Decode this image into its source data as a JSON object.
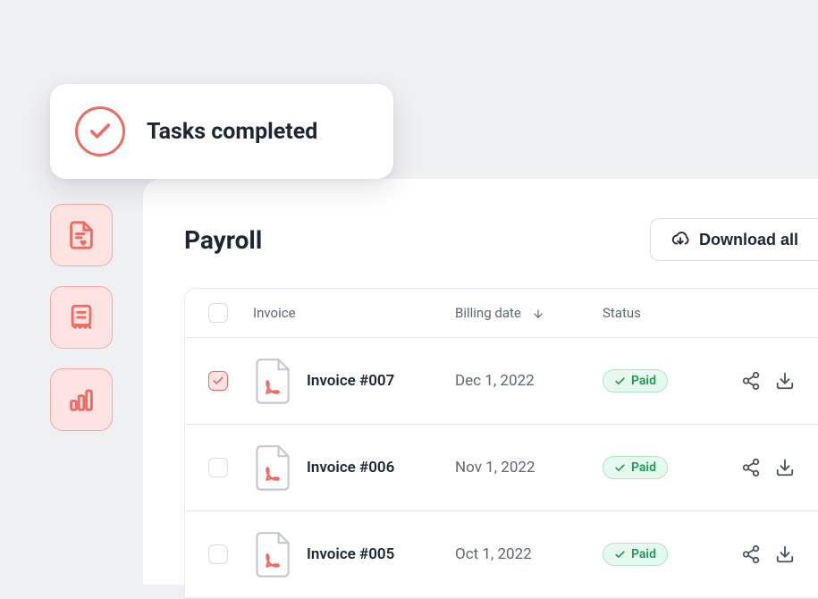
{
  "toast": {
    "message": "Tasks completed"
  },
  "sidebar": {
    "items": [
      {
        "name": "document-heart-icon"
      },
      {
        "name": "receipt-icon"
      },
      {
        "name": "bar-chart-icon"
      }
    ]
  },
  "panel": {
    "title": "Payroll",
    "download_all_label": "Download all"
  },
  "table": {
    "columns": {
      "invoice": "Invoice",
      "billing_date": "Billing date",
      "status": "Status"
    },
    "sort": {
      "column": "billing_date",
      "direction": "desc"
    },
    "rows": [
      {
        "checked": true,
        "name": "Invoice #007",
        "date": "Dec 1, 2022",
        "status": "Paid"
      },
      {
        "checked": false,
        "name": "Invoice #006",
        "date": "Nov 1, 2022",
        "status": "Paid"
      },
      {
        "checked": false,
        "name": "Invoice #005",
        "date": "Oct 1, 2022",
        "status": "Paid"
      }
    ]
  }
}
